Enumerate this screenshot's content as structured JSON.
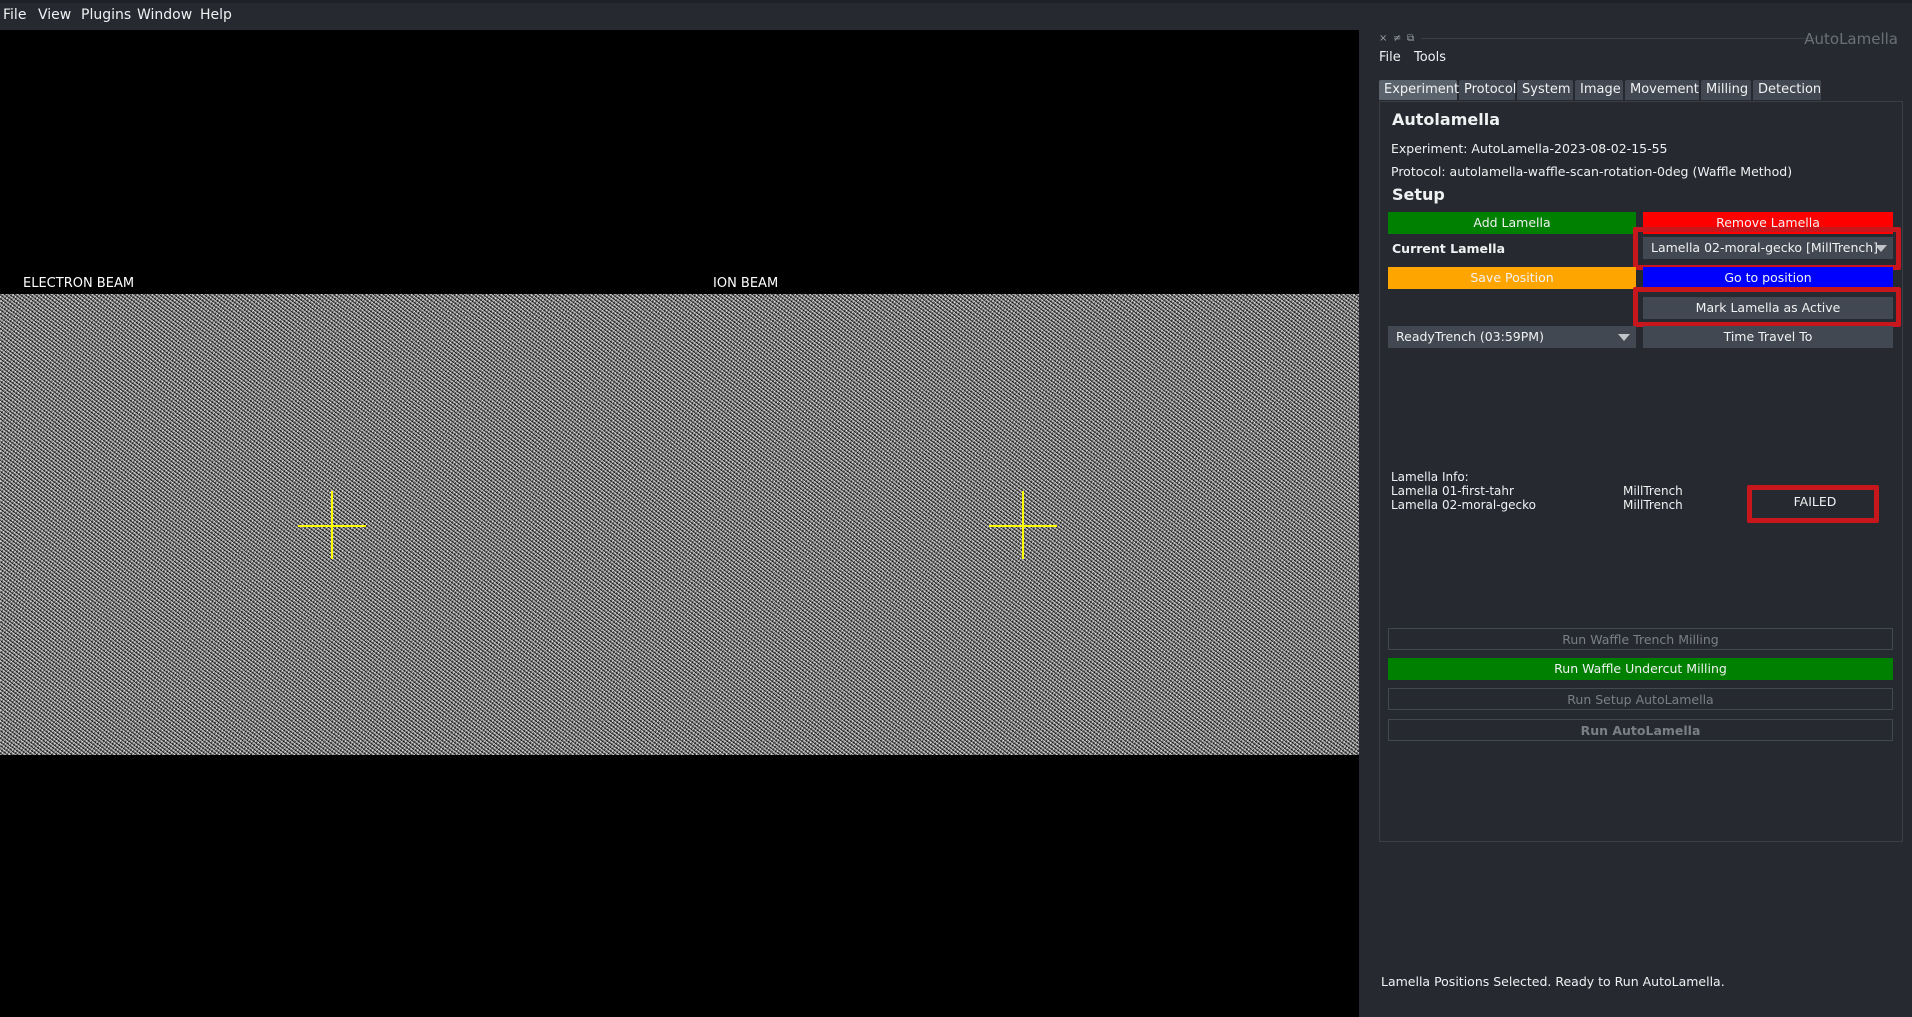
{
  "menubar": {
    "items": [
      "File",
      "View",
      "Plugins",
      "Window",
      "Help"
    ]
  },
  "viewer": {
    "electron_label": "ELECTRON BEAM",
    "ion_label": "ION BEAM"
  },
  "dock": {
    "controls": [
      "×",
      "≠",
      "⧉"
    ],
    "title": "AutoLamella",
    "menu": [
      "File",
      "Tools"
    ],
    "tabs": [
      "Experiment",
      "Protocol",
      "System",
      "Image",
      "Movement",
      "Milling",
      "Detection"
    ],
    "active_tab": "Experiment"
  },
  "experiment": {
    "heading": "Autolamella",
    "experiment_line": "Experiment: AutoLamella-2023-08-02-15-55",
    "protocol_line": "Protocol: autolamella-waffle-scan-rotation-0deg (Waffle Method)",
    "setup_heading": "Setup",
    "add_lamella": "Add Lamella",
    "remove_lamella": "Remove Lamella",
    "current_lamella_label": "Current Lamella",
    "current_lamella_value": "Lamella 02-moral-gecko [MillTrench]",
    "save_position": "Save Position",
    "go_to_position": "Go to position",
    "mark_active": "Mark Lamella as Active",
    "state_value": "ReadyTrench (03:59PM)",
    "time_travel": "Time Travel To",
    "lamella_info_label": "Lamella Info:",
    "lamella_rows": [
      {
        "name": "Lamella 01-first-tahr",
        "state": "MillTrench",
        "status": ""
      },
      {
        "name": "Lamella 02-moral-gecko",
        "state": "MillTrench",
        "status": "FAILED"
      }
    ],
    "run_trench": "Run Waffle Trench Milling",
    "run_undercut": "Run Waffle Undercut Milling",
    "run_setup": "Run Setup AutoLamella",
    "run_autolamella": "Run AutoLamella"
  },
  "status_bar": {
    "message": "Lamella Positions Selected. Ready to Run AutoLamella."
  },
  "colors": {
    "green": "#008000",
    "red": "#ff0000",
    "orange": "#ffa500",
    "blue": "#0000ff",
    "highlight": "#c8161d",
    "crosshair": "#ffff00"
  }
}
